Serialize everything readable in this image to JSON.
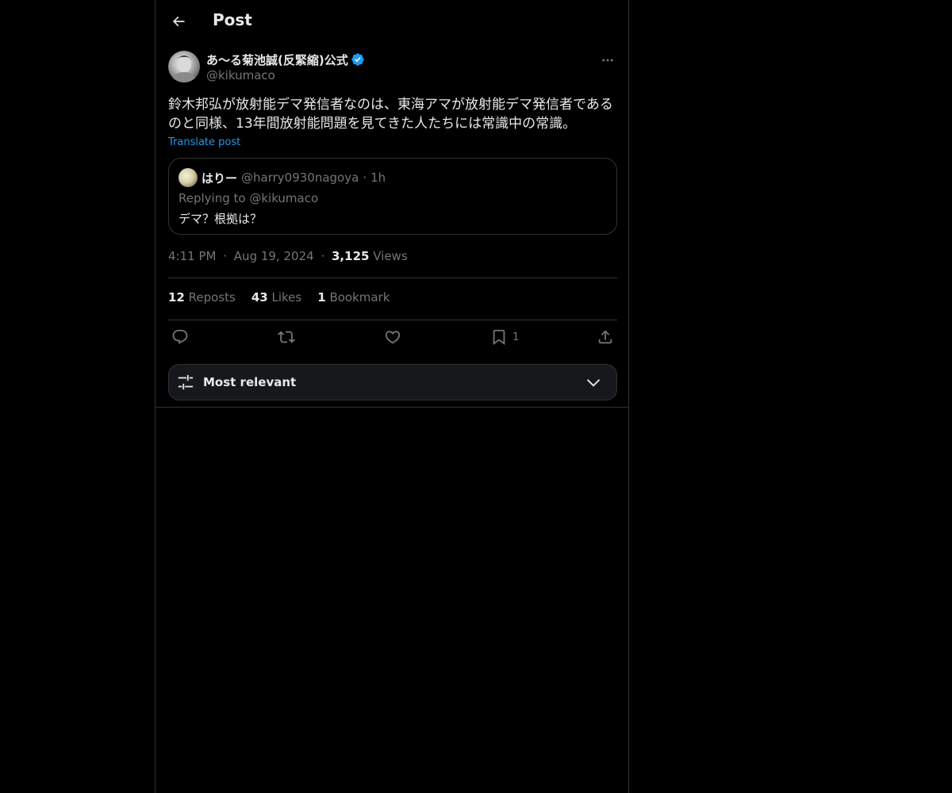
{
  "header": {
    "title": "Post",
    "back_icon": "arrow-left-icon"
  },
  "post": {
    "author": {
      "display_name": "あ〜る菊池誠(反緊縮)公式",
      "handle": "@kikumaco",
      "verified": true
    },
    "text": "鈴木邦弘が放射能デマ発信者なのは、東海アマが放射能デマ発信者であるのと同様、13年間放射能問題を見てきた人たちには常識中の常識。",
    "translate_label": "Translate post",
    "quote": {
      "name": "はりー",
      "handle": "@harry0930nagoya",
      "dot": "·",
      "time": "1h",
      "replying_to": "Replying to @kikumaco",
      "text": "デマ？根拠は？"
    },
    "meta": {
      "time": "4:11 PM",
      "dot1": "·",
      "date": "Aug 19, 2024",
      "dot2": "·",
      "views_count": "3,125",
      "views_label": "Views"
    },
    "stats": {
      "reposts_count": "12",
      "reposts_label": "Reposts",
      "likes_count": "43",
      "likes_label": "Likes",
      "bookmarks_count": "1",
      "bookmarks_label": "Bookmark"
    },
    "actions": {
      "bookmark_count": "1"
    }
  },
  "replies_sort": {
    "label": "Most relevant"
  },
  "colors": {
    "background": "#000000",
    "text_primary": "#e7e9ea",
    "text_secondary": "#71767b",
    "accent": "#1d9bf0",
    "border": "#2f3336"
  }
}
